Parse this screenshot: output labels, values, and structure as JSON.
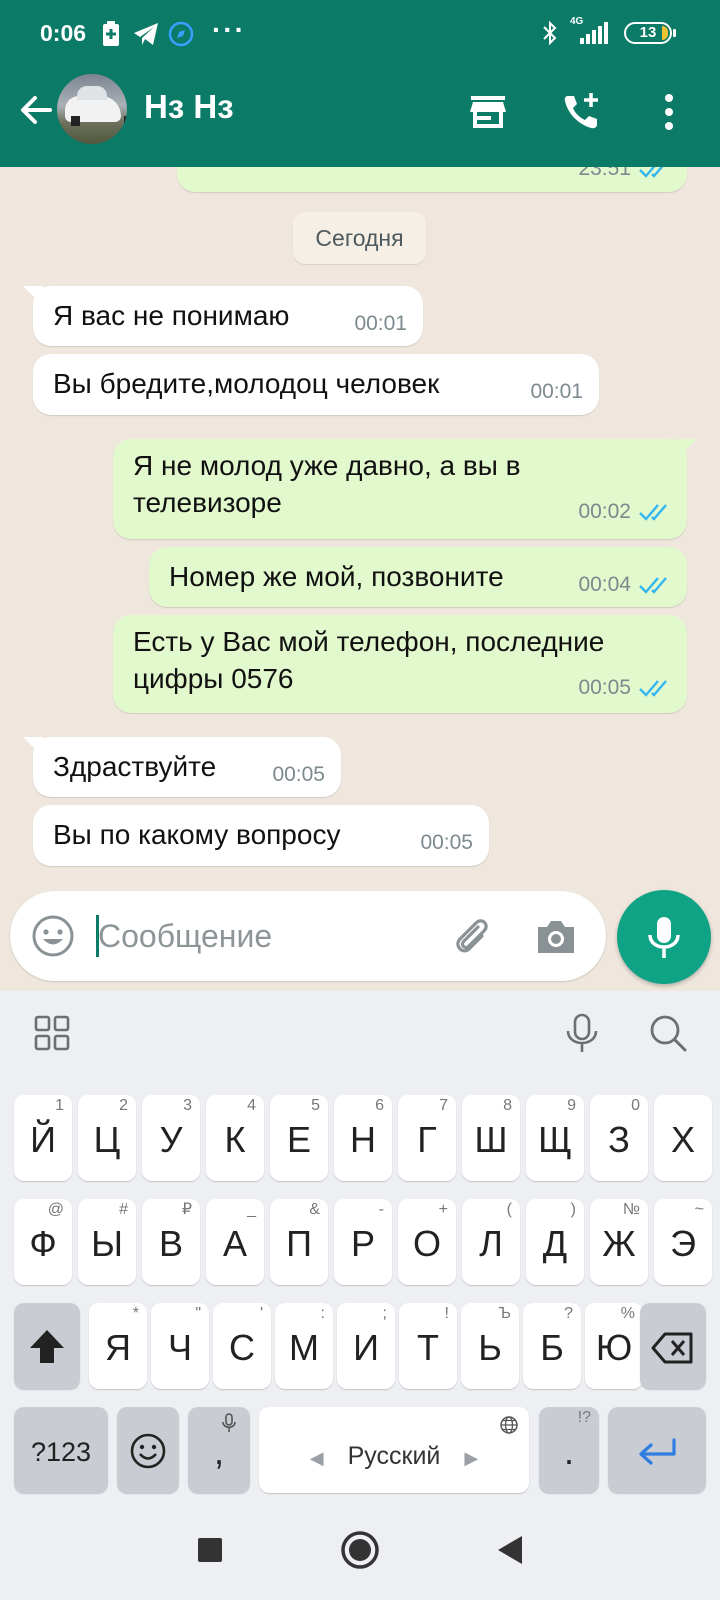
{
  "status_bar": {
    "time": "0:06",
    "network": "4G",
    "battery": "13"
  },
  "header": {
    "contact_name": "Нз Нз",
    "icons": [
      "back-arrow-icon",
      "store-icon",
      "add-call-icon",
      "more-vert-icon"
    ]
  },
  "chat": {
    "prev_time": "23:51",
    "date_chip": "Сегодня",
    "messages": [
      {
        "dir": "in",
        "text": "Я вас не понимаю",
        "time": "00:01"
      },
      {
        "dir": "in",
        "text": "Вы бредите,молодоц человек",
        "time": "00:01"
      },
      {
        "dir": "out",
        "text": "Я не молод уже давно, а вы в телевизоре",
        "time": "00:02"
      },
      {
        "dir": "out",
        "text": "Номер же мой, позвоните",
        "time": "00:04"
      },
      {
        "dir": "out",
        "text": "Есть у Вас мой телефон, последние цифры 0576",
        "time": "00:05"
      },
      {
        "dir": "in",
        "text": "Здраствуйте",
        "time": "00:05"
      },
      {
        "dir": "in",
        "text": "Вы по какому вопросу",
        "time": "00:05"
      }
    ]
  },
  "composer": {
    "placeholder": "Сообщение"
  },
  "keyboard": {
    "rows": [
      {
        "keys": [
          "Й",
          "Ц",
          "У",
          "К",
          "Е",
          "Н",
          "Г",
          "Ш",
          "Щ",
          "З",
          "Х"
        ],
        "hints": [
          "1",
          "2",
          "3",
          "4",
          "5",
          "6",
          "7",
          "8",
          "9",
          "0",
          ""
        ]
      },
      {
        "keys": [
          "Ф",
          "Ы",
          "В",
          "А",
          "П",
          "Р",
          "О",
          "Л",
          "Д",
          "Ж",
          "Э"
        ],
        "hints": [
          "@",
          "#",
          "₽",
          "_",
          "&",
          "-",
          "+",
          "(",
          ")",
          "№",
          "~"
        ]
      },
      {
        "keys": [
          "Я",
          "Ч",
          "С",
          "М",
          "И",
          "Т",
          "Ь",
          "Б",
          "Ю"
        ],
        "hints": [
          "*",
          "\"",
          "'",
          ":",
          ";",
          "!",
          "Ъ",
          "?",
          "%"
        ]
      }
    ],
    "symbols_key": "?123",
    "comma_key": ",",
    "space_label": "Русский",
    "period_key": ".",
    "period_hint": "!?"
  },
  "colors": {
    "header_bg": "#0b7a67",
    "outgoing_bubble": "#e2f8cd",
    "incoming_bubble": "#ffffff",
    "read_ticks": "#34b7f1",
    "fab": "#0fa386"
  }
}
